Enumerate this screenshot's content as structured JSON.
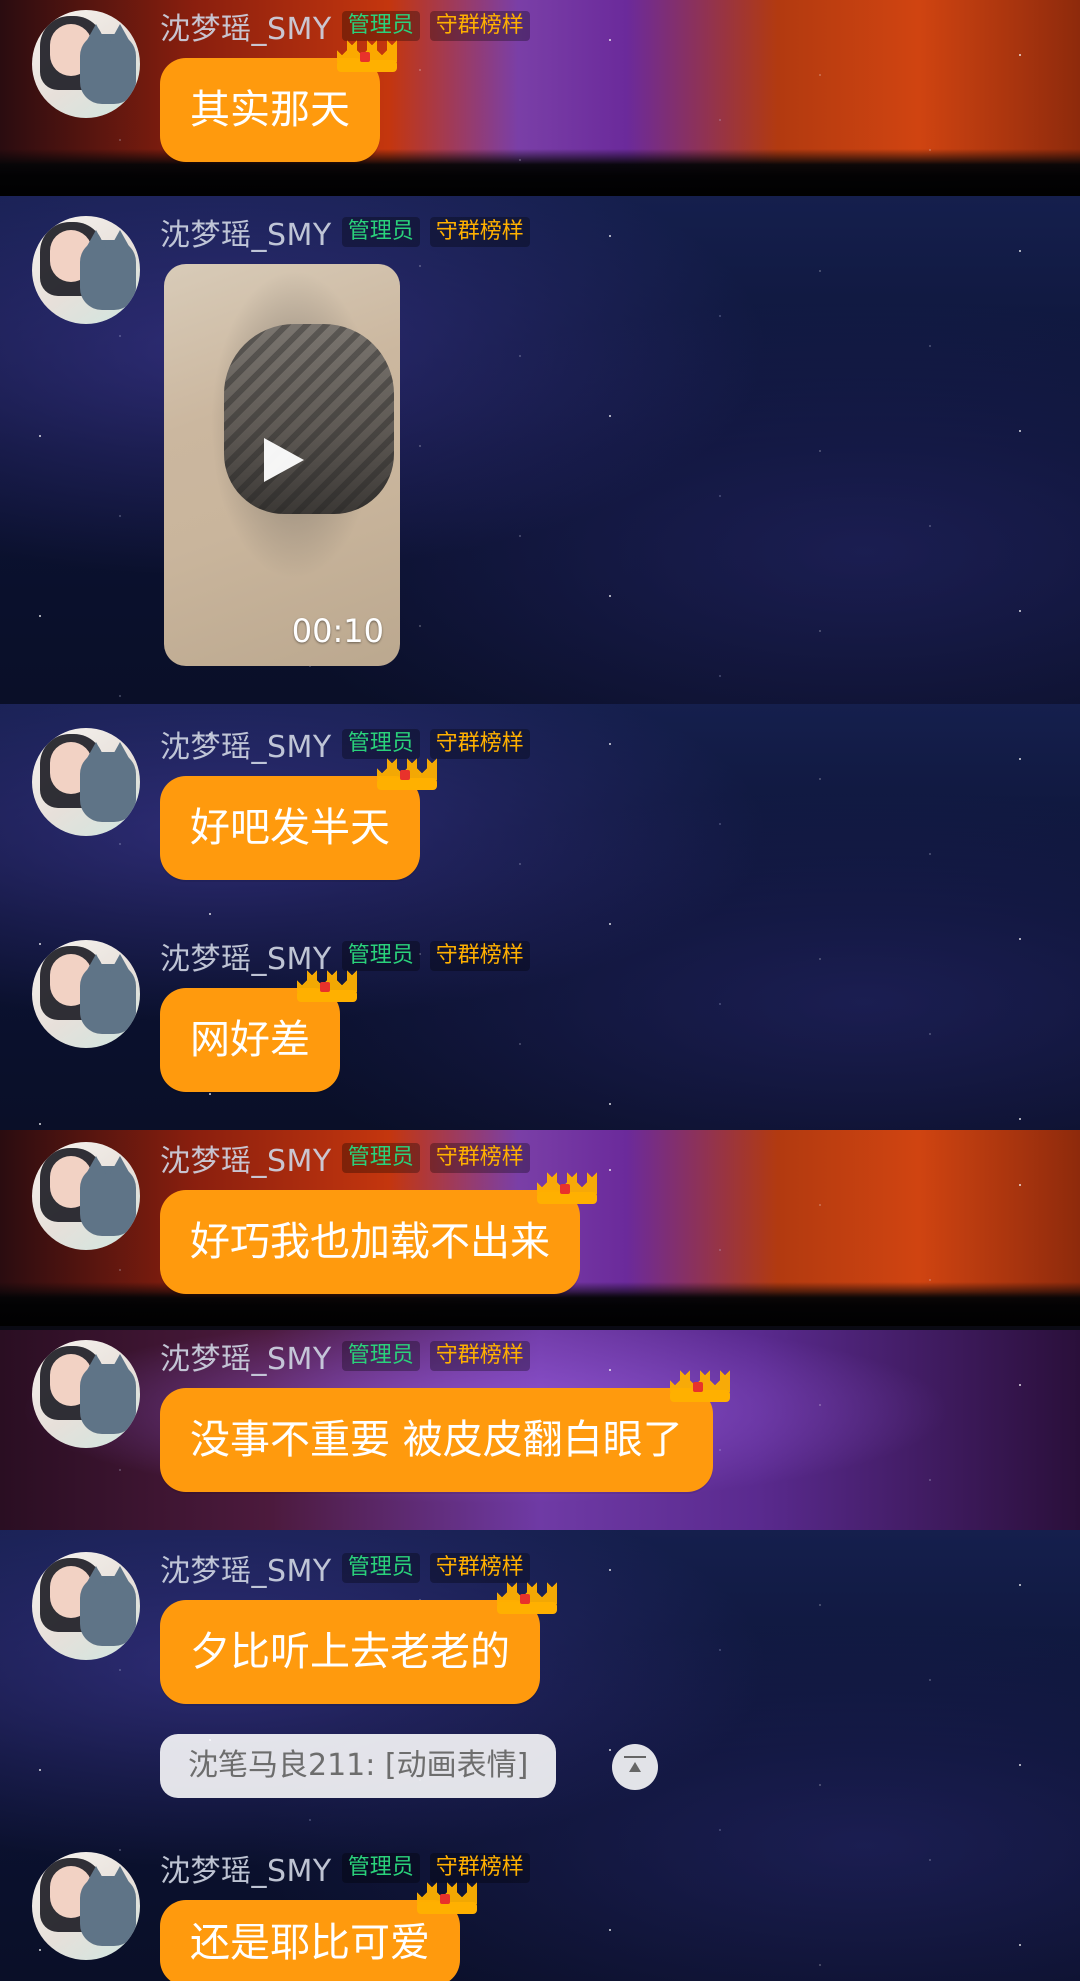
{
  "chat": {
    "messages": [
      {
        "sender": "沈梦瑶_SMY",
        "badges": [
          "管理员",
          "守群榜样"
        ],
        "text": "其实那天"
      },
      {
        "sender": "沈梦瑶_SMY",
        "badges": [
          "管理员",
          "守群榜样"
        ],
        "video": {
          "duration": "00:10"
        }
      },
      {
        "sender": "沈梦瑶_SMY",
        "badges": [
          "管理员",
          "守群榜样"
        ],
        "text": "好吧发半天"
      },
      {
        "sender": "沈梦瑶_SMY",
        "badges": [
          "管理员",
          "守群榜样"
        ],
        "text": "网好差"
      },
      {
        "sender": "沈梦瑶_SMY",
        "badges": [
          "管理员",
          "守群榜样"
        ],
        "text": "好巧我也加载不出来"
      },
      {
        "sender": "沈梦瑶_SMY",
        "badges": [
          "管理员",
          "守群榜样"
        ],
        "text": "没事不重要 被皮皮翻白眼了"
      },
      {
        "sender": "沈梦瑶_SMY",
        "badges": [
          "管理员",
          "守群榜样"
        ],
        "text": "夕比听上去老老的",
        "quote": "沈笔马良211: [动画表情]"
      },
      {
        "sender": "沈梦瑶_SMY",
        "badges": [
          "管理员",
          "守群榜样"
        ],
        "text": "还是耶比可爱"
      }
    ]
  },
  "colors": {
    "bubble": "#ff9a0d",
    "badge_admin": "#2ad27b",
    "badge_model": "#ffb000"
  },
  "icons": {
    "crown": "crown-icon",
    "play": "play-icon",
    "scroll_to_top": "arrow-up-icon"
  }
}
